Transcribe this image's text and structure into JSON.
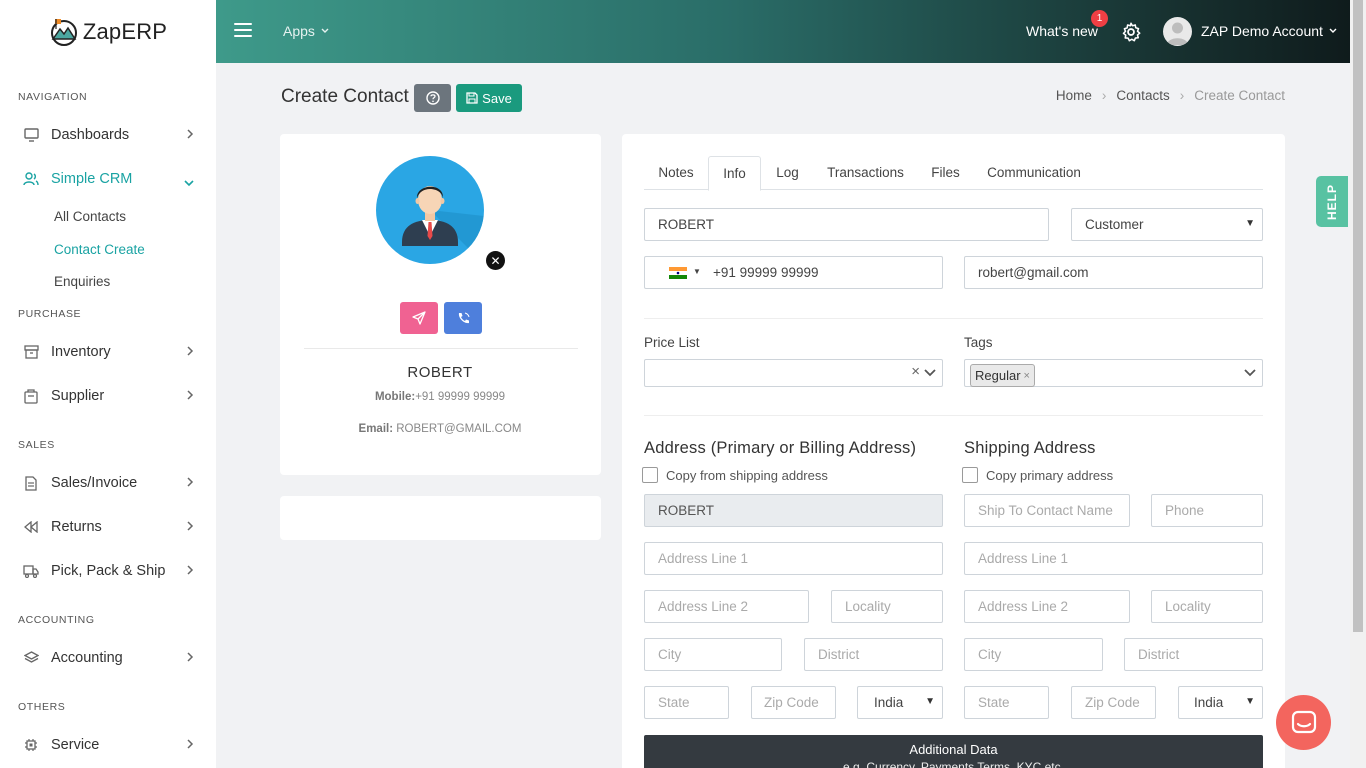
{
  "app": {
    "name": "ZapERP"
  },
  "topbar": {
    "apps_label": "Apps",
    "whats_new": "What's new",
    "notification_count": "1",
    "account_name": "ZAP Demo Account"
  },
  "sidebar": {
    "sections": {
      "navigation": "NAVIGATION",
      "purchase": "PURCHASE",
      "sales": "SALES",
      "accounting": "ACCOUNTING",
      "others": "OTHERS"
    },
    "items": {
      "dashboards": "Dashboards",
      "simple_crm": "Simple CRM",
      "all_contacts": "All Contacts",
      "contact_create": "Contact Create",
      "enquiries": "Enquiries",
      "inventory": "Inventory",
      "supplier": "Supplier",
      "sales_invoice": "Sales/Invoice",
      "returns": "Returns",
      "pick_pack_ship": "Pick, Pack & Ship",
      "accounting": "Accounting",
      "service": "Service"
    }
  },
  "header": {
    "title": "Create Contact",
    "save_label": "Save"
  },
  "breadcrumb": {
    "home": "Home",
    "contacts": "Contacts",
    "current": "Create Contact"
  },
  "profile": {
    "name": "ROBERT",
    "mobile_label": "Mobile:",
    "mobile": "+91 99999 99999",
    "email_label": "Email:",
    "email": "ROBERT@GMAIL.COM"
  },
  "tabs": {
    "notes": "Notes",
    "info": "Info",
    "log": "Log",
    "transactions": "Transactions",
    "files": "Files",
    "communication": "Communication"
  },
  "form": {
    "name": "ROBERT",
    "contact_type": "Customer",
    "phone": "+91 99999 99999",
    "email": "robert@gmail.com",
    "price_list_label": "Price List",
    "tags_label": "Tags",
    "tag_regular": "Regular",
    "billing_title": "Address (Primary or Billing Address)",
    "copy_shipping": "Copy from shipping address",
    "billing_name": "ROBERT",
    "shipping_title": "Shipping Address",
    "copy_primary": "Copy primary address",
    "ph_ship_name": "Ship To Contact Name",
    "ph_phone": "Phone",
    "ph_addr1": "Address Line 1",
    "ph_addr2": "Address Line 2",
    "ph_locality": "Locality",
    "ph_city": "City",
    "ph_district": "District",
    "ph_state": "State",
    "ph_zip": "Zip Code",
    "country": "India"
  },
  "additional": {
    "title": "Additional Data",
    "subtitle": "e.g. Currency, Payments Terms, KYC etc."
  },
  "help_tab": "HELP",
  "colors": {
    "accent": "#1aa3a3",
    "save": "#1a9a7e",
    "pink": "#f06292",
    "blue": "#4e7fdc",
    "chat": "#f3655e"
  }
}
